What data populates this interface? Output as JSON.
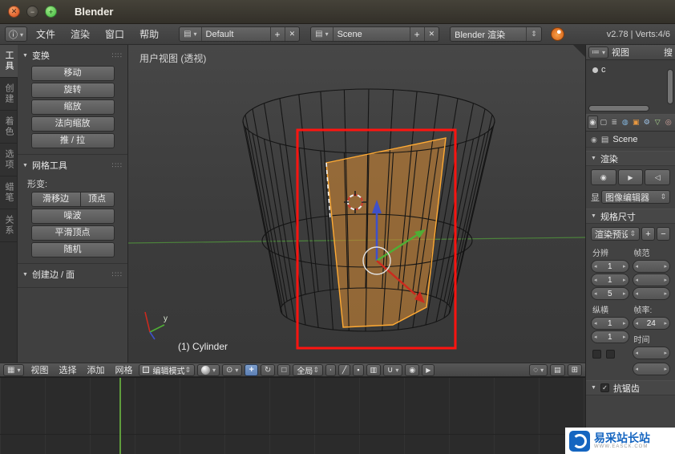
{
  "colors": {
    "selection_orange": "#c98436",
    "selection_edge": "#ffaa33",
    "border_red": "#ff1410",
    "axis_x_red": "#cc2a1e",
    "axis_y_green": "#4fae35",
    "axis_z_blue": "#3f51c9",
    "grid_green": "#4e8a3c",
    "playhead_green": "#5f9c3c"
  },
  "titlebar": {
    "title": "Blender"
  },
  "menubar": {
    "menus": [
      "文件",
      "渲染",
      "窗口",
      "帮助"
    ],
    "layout_value": "Default",
    "scene_value": "Scene",
    "engine_value": "Blender 渲染",
    "stats": "v2.78 | Verts:4/6"
  },
  "toolshelf": {
    "tabs": [
      {
        "label": "工具"
      },
      {
        "label": "创建"
      },
      {
        "label": "着色"
      },
      {
        "label": "选项"
      },
      {
        "label": "蜡笔"
      },
      {
        "label": "关系"
      }
    ],
    "transform_panel": {
      "title": "变换",
      "buttons": [
        "移动",
        "旋转",
        "缩放",
        "法向缩放",
        "推 / 拉"
      ]
    },
    "meshtools_panel": {
      "title": "网格工具",
      "deform_label": "形变:",
      "slide_buttons": [
        "滑移边",
        "顶点"
      ],
      "buttons": [
        "噪波",
        "平滑顶点",
        "随机"
      ]
    },
    "makeedge_panel": {
      "title": "创建边 / 面"
    }
  },
  "viewport": {
    "view_label": "用户视图 (透视)",
    "object_label": "(1) Cylinder",
    "axis_label": "y"
  },
  "viewport_header": {
    "menus": [
      "视图",
      "选择",
      "添加",
      "网格"
    ],
    "mode_label": "编辑模式",
    "global_label": "全局"
  },
  "outliner": {
    "view_label": "视图",
    "search_label": "搜",
    "item_label": "c"
  },
  "properties": {
    "breadcrumb": "Scene",
    "render_panel": {
      "title": "渲染",
      "display_label": "显",
      "display_value": "图像编辑器"
    },
    "dimensions_panel": {
      "title": "规格尺寸",
      "preset_value": "渲染预设",
      "resolution_label": "分辨",
      "frame_label": "帧范",
      "resolution_values": [
        "1",
        "1",
        "5"
      ],
      "frame_values": [
        "",
        "",
        ""
      ],
      "aspect_label": "纵横",
      "aspect_values": [
        "1",
        "1"
      ],
      "framerate_label": "帧率:",
      "framerate_value": "24",
      "time_label": "时间",
      "time_values": [
        "",
        ""
      ]
    },
    "aa_panel": {
      "title": "抗锯齿"
    }
  },
  "watermark": {
    "title": "易采站长站",
    "subtitle": "WWW.EASCK.COM"
  }
}
